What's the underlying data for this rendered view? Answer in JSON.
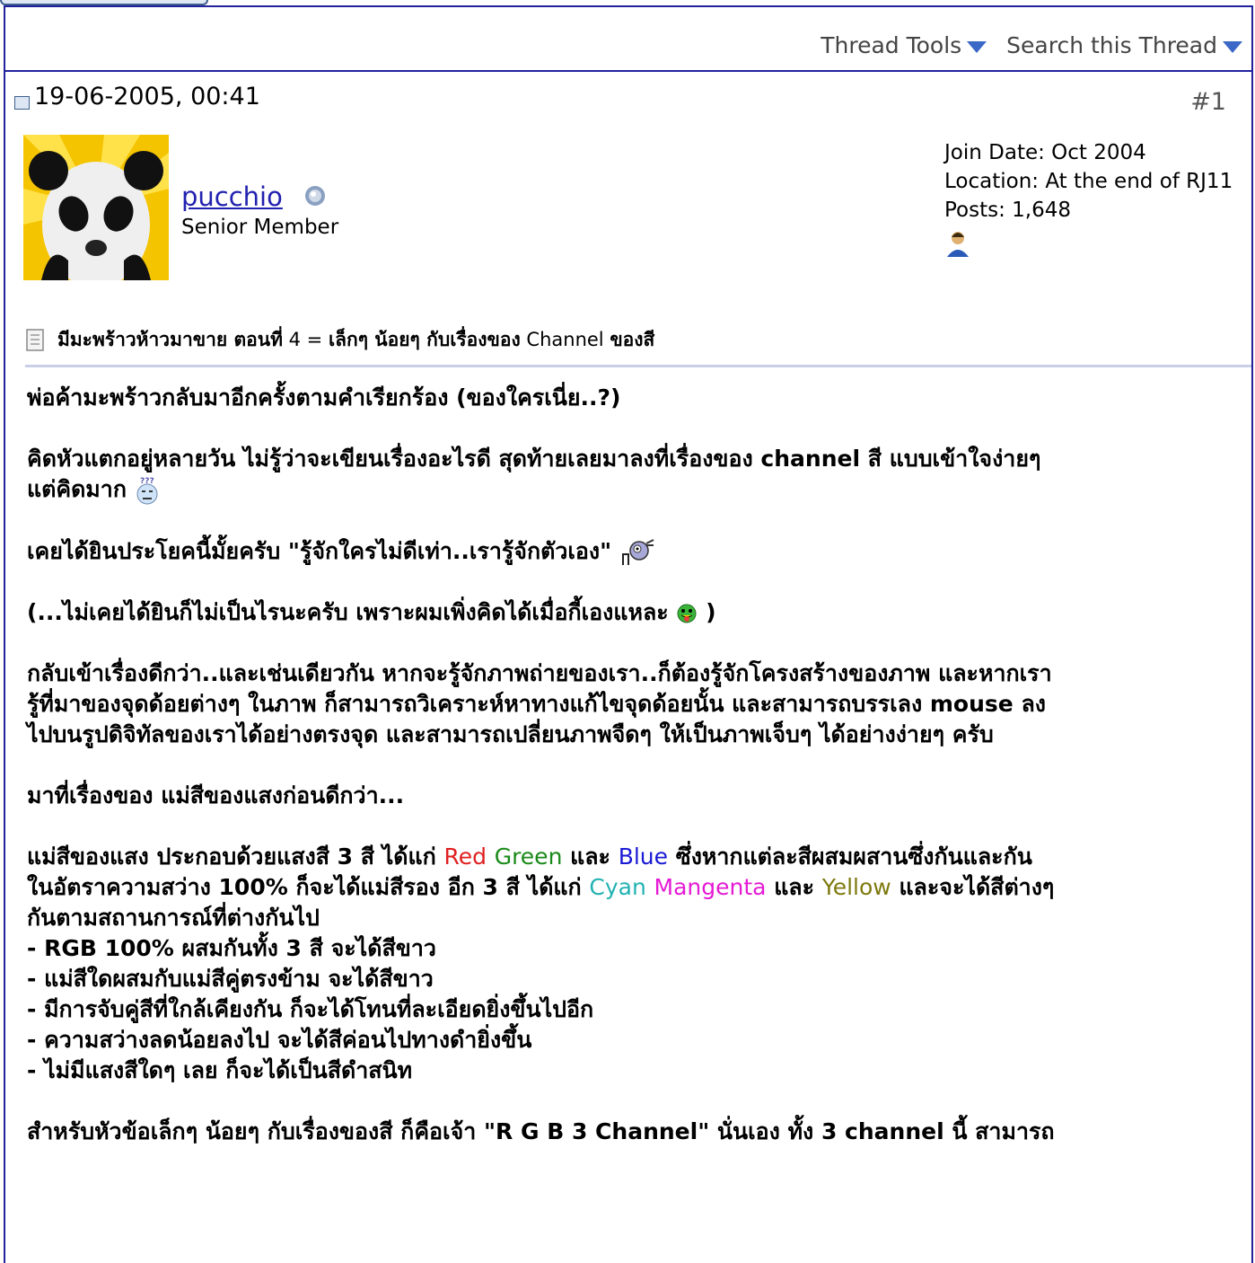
{
  "toolbar": {
    "thread_tools": "Thread Tools",
    "search_thread": "Search this Thread"
  },
  "post": {
    "date": "19-06-2005, 00:41",
    "number": "#1",
    "username": "pucchio",
    "user_title": "Senior Member",
    "join_date": "Join Date: Oct 2004",
    "location": "Location: At the end of RJ11",
    "posts": "Posts: 1,648",
    "title_part1": "มีมะพร้าวห้าวมาขาย ตอนที่",
    "title_part2": " 4 = ",
    "title_part3": "เล็กๆ น้อยๆ กับเรื่องของ",
    "title_part4": " Channel ",
    "title_part5": "ของสี"
  },
  "body": {
    "p1": "พ่อค้ามะพร้าวกลับมาอีกครั้งตามคำเรียกร้อง (ของใครเนี่ย..?)",
    "p2a": "คิดหัวแตกอยู่หลายวัน ไม่รู้ว่าจะเขียนเรื่องอะไรดี สุดท้ายเลยมาลงที่เรื่องของ channel สี แบบเข้าใจง่ายๆ",
    "p2b": "แต่คิดมาก",
    "p3": "เคยได้ยินประโยคนี้มั้ยครับ \"รู้จักใครไม่ดีเท่า..เรารู้จักตัวเอง\"",
    "p4a": "(...ไม่เคยได้ยินก็ไม่เป็นไรนะครับ เพราะผมเพิ่งคิดได้เมื่อกี้เองแหละ",
    "p4b": " )",
    "p5a": "กลับเข้าเรื่องดีกว่า..และเช่นเดียวกัน หากจะรู้จักภาพถ่ายของเรา..ก็ต้องรู้จักโครงสร้างของภาพ และหากเรา",
    "p5b": "รู้ที่มาของจุดด้อยต่างๆ ในภาพ ก็สามารถวิเคราะห์หาทางแก้ไขจุดด้อยนั้น และสามารถบรรเลง mouse ลง",
    "p5c": "ไปบนรูปดิจิทัลของเราได้อย่างตรงจุด และสามารถเปลี่ยนภาพจืดๆ ให้เป็นภาพเจ็บๆ ได้อย่างง่ายๆ ครับ",
    "p6": "มาที่เรื่องของ แม่สีของแสงก่อนดีกว่า...",
    "p7a1": "แม่สีของแสง ประกอบด้วยแสงสี 3 สี ได้แก่ ",
    "red": "Red",
    "green": "Green",
    "and1": " และ ",
    "blue": "Blue",
    "p7a2": " ซึ่งหากแต่ละสีผสมผสานซึ่งกันและกัน",
    "p7b1": "ในอัตราความสว่าง 100% ก็จะได้แม่สีรอง อีก 3 สี ได้แก่ ",
    "cyan": "Cyan",
    "magenta": "Mangenta",
    "and2": " และ ",
    "yellow": "Yellow",
    "p7b2": " และจะได้สีต่างๆ",
    "p7c": "กันตามสถานการณ์ที่ต่างกันไป",
    "l1": "- RGB 100% ผสมกันทั้ง 3 สี จะได้สีขาว",
    "l2": "- แม่สีใดผสมกับแม่สีคู่ตรงข้าม จะได้สีขาว",
    "l3": "- มีการจับคู่สีที่ใกล้เคียงกัน ก็จะได้โทนที่ละเอียดยิ่งขึ้นไปอีก",
    "l4": "- ความสว่างลดน้อยลงไป จะได้สีค่อนไปทางดำยิ่งขึ้น",
    "l5": "- ไม่มีแสงสีใดๆ เลย ก็จะได้เป็นสีดำสนิท",
    "p8": "สำหรับหัวข้อเล็กๆ น้อยๆ กับเรื่องของสี ก็คือเจ้า \"R G B 3 Channel\" นั่นเอง ทั้ง 3 channel นี้ สามารถ"
  }
}
